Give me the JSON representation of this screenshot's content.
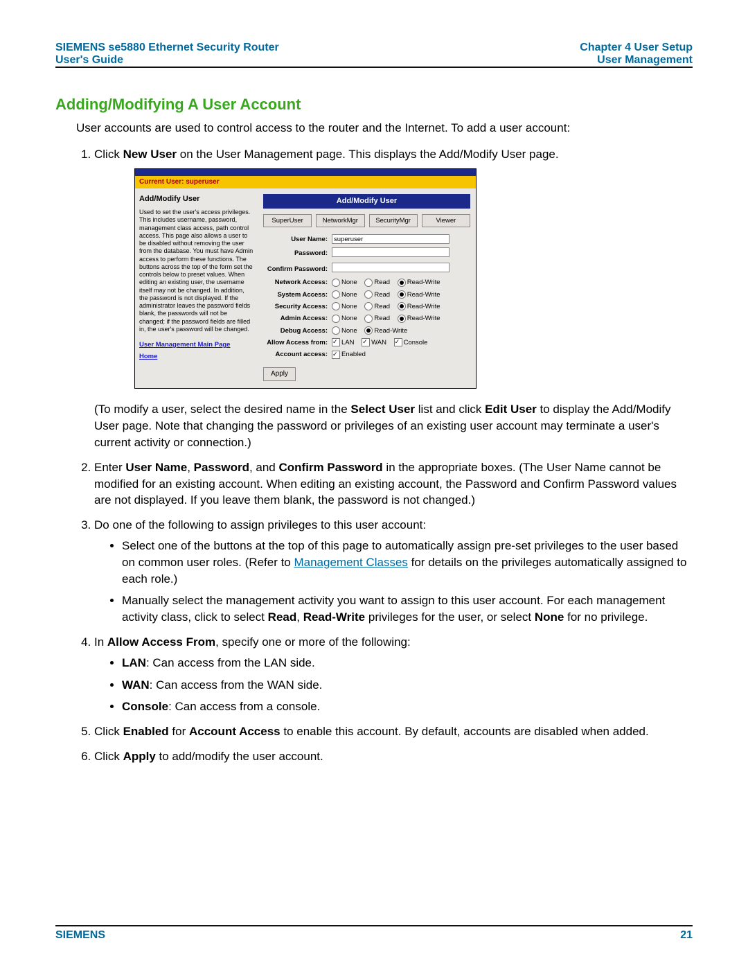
{
  "header": {
    "left1": "SIEMENS se5880 Ethernet Security Router",
    "left2": "User's Guide",
    "right1": "Chapter 4  User Setup",
    "right2": "User Management"
  },
  "title": "Adding/Modifying A User Account",
  "intro": "User accounts are used to control access to the router and the Internet. To add a user account:",
  "step1": {
    "pre": "Click ",
    "b": "New User",
    "post": " on the User Management page. This displays the Add/Modify User page."
  },
  "after1": {
    "a": "(To modify a user, select the desired name in the ",
    "b": "Select User",
    "c": " list and click ",
    "d": "Edit User",
    "e": " to display the Add/Modify User page. Note that changing the password or privileges of an existing user account may terminate a user's current activity or connection.)"
  },
  "step2": {
    "a": "Enter ",
    "b": "User Name",
    "c": ", ",
    "d": "Password",
    "e": ", and ",
    "f": "Confirm Password",
    "g": " in the appropriate boxes. (The User Name cannot be modified for an existing account. When editing an existing account, the Password and Confirm Password values are not displayed. If you leave them blank, the password is not changed.)"
  },
  "step3": {
    "intro": "Do one of the following to assign privileges to this user account:",
    "b1a": "Select one of the buttons at the top of this page to automatically assign pre-set privileges to the user based on common user roles. (Refer to ",
    "b1link": "Management Classes",
    "b1b": " for details on the privileges automatically assigned to each role.)",
    "b2a": "Manually select the management activity you want to assign to this user account. For each management activity class, click to select ",
    "b2b": "Read",
    "b2c": ", ",
    "b2d": "Read-Write",
    "b2e": " privileges for the user, or select ",
    "b2f": "None",
    "b2g": " for no privilege."
  },
  "step4": {
    "a": "In ",
    "b": "Allow Access From",
    "c": ", specify one or more of the following:",
    "lan_b": "LAN",
    "lan": ": Can access from the LAN side.",
    "wan_b": "WAN",
    "wan": ": Can access from the WAN side.",
    "con_b": "Console",
    "con": ": Can access from a console."
  },
  "step5": {
    "a": "Click ",
    "b": "Enabled",
    "c": " for ",
    "d": "Account Access",
    "e": " to enable this account. By default, accounts are disabled when added."
  },
  "step6": {
    "a": "Click ",
    "b": "Apply",
    "c": " to add/modify the user account."
  },
  "shot": {
    "bar": "Current User: superuser",
    "left_title": "Add/Modify User",
    "left_desc": "Used to set the user's access privileges. This includes username, password, management class access, path control access. This page also allows a user to be disabled without removing the user from the database. You must have Admin access to perform these functions. The buttons across the top of the form set the controls below to preset values.\nWhen editing an existing user, the username itself may not be changed. In addition, the password is not displayed. If the administrator leaves the password fields blank, the passwords will not be changed; if the password fields are filled in, the user's password will be changed.",
    "left_link1": "User Management Main Page",
    "left_link2": "Home",
    "panel": "Add/Modify User",
    "presets": [
      "SuperUser",
      "NetworkMgr",
      "SecurityMgr",
      "Viewer"
    ],
    "f_user": "User Name:",
    "v_user": "superuser",
    "f_pass": "Password:",
    "f_conf": "Confirm Password:",
    "rows": [
      "Network Access:",
      "System Access:",
      "Security Access:",
      "Admin Access:"
    ],
    "opts": {
      "none": "None",
      "read": "Read",
      "rw": "Read-Write"
    },
    "f_debug": "Debug Access:",
    "f_allow": "Allow Access from:",
    "allow": [
      "LAN",
      "WAN",
      "Console"
    ],
    "f_acct": "Account access:",
    "enabled": "Enabled",
    "apply": "Apply"
  },
  "footer": {
    "left": "SIEMENS",
    "right": "21"
  }
}
